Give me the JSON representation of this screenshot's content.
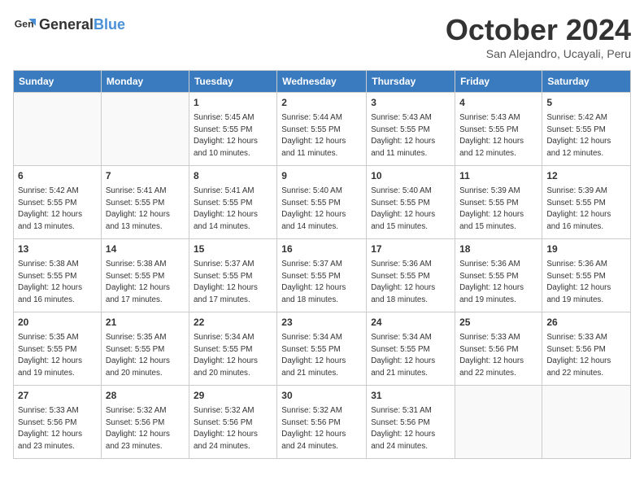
{
  "logo": {
    "general": "General",
    "blue": "Blue"
  },
  "header": {
    "month": "October 2024",
    "location": "San Alejandro, Ucayali, Peru"
  },
  "weekdays": [
    "Sunday",
    "Monday",
    "Tuesday",
    "Wednesday",
    "Thursday",
    "Friday",
    "Saturday"
  ],
  "weeks": [
    [
      {
        "day": "",
        "detail": ""
      },
      {
        "day": "",
        "detail": ""
      },
      {
        "day": "1",
        "detail": "Sunrise: 5:45 AM\nSunset: 5:55 PM\nDaylight: 12 hours\nand 10 minutes."
      },
      {
        "day": "2",
        "detail": "Sunrise: 5:44 AM\nSunset: 5:55 PM\nDaylight: 12 hours\nand 11 minutes."
      },
      {
        "day": "3",
        "detail": "Sunrise: 5:43 AM\nSunset: 5:55 PM\nDaylight: 12 hours\nand 11 minutes."
      },
      {
        "day": "4",
        "detail": "Sunrise: 5:43 AM\nSunset: 5:55 PM\nDaylight: 12 hours\nand 12 minutes."
      },
      {
        "day": "5",
        "detail": "Sunrise: 5:42 AM\nSunset: 5:55 PM\nDaylight: 12 hours\nand 12 minutes."
      }
    ],
    [
      {
        "day": "6",
        "detail": "Sunrise: 5:42 AM\nSunset: 5:55 PM\nDaylight: 12 hours\nand 13 minutes."
      },
      {
        "day": "7",
        "detail": "Sunrise: 5:41 AM\nSunset: 5:55 PM\nDaylight: 12 hours\nand 13 minutes."
      },
      {
        "day": "8",
        "detail": "Sunrise: 5:41 AM\nSunset: 5:55 PM\nDaylight: 12 hours\nand 14 minutes."
      },
      {
        "day": "9",
        "detail": "Sunrise: 5:40 AM\nSunset: 5:55 PM\nDaylight: 12 hours\nand 14 minutes."
      },
      {
        "day": "10",
        "detail": "Sunrise: 5:40 AM\nSunset: 5:55 PM\nDaylight: 12 hours\nand 15 minutes."
      },
      {
        "day": "11",
        "detail": "Sunrise: 5:39 AM\nSunset: 5:55 PM\nDaylight: 12 hours\nand 15 minutes."
      },
      {
        "day": "12",
        "detail": "Sunrise: 5:39 AM\nSunset: 5:55 PM\nDaylight: 12 hours\nand 16 minutes."
      }
    ],
    [
      {
        "day": "13",
        "detail": "Sunrise: 5:38 AM\nSunset: 5:55 PM\nDaylight: 12 hours\nand 16 minutes."
      },
      {
        "day": "14",
        "detail": "Sunrise: 5:38 AM\nSunset: 5:55 PM\nDaylight: 12 hours\nand 17 minutes."
      },
      {
        "day": "15",
        "detail": "Sunrise: 5:37 AM\nSunset: 5:55 PM\nDaylight: 12 hours\nand 17 minutes."
      },
      {
        "day": "16",
        "detail": "Sunrise: 5:37 AM\nSunset: 5:55 PM\nDaylight: 12 hours\nand 18 minutes."
      },
      {
        "day": "17",
        "detail": "Sunrise: 5:36 AM\nSunset: 5:55 PM\nDaylight: 12 hours\nand 18 minutes."
      },
      {
        "day": "18",
        "detail": "Sunrise: 5:36 AM\nSunset: 5:55 PM\nDaylight: 12 hours\nand 19 minutes."
      },
      {
        "day": "19",
        "detail": "Sunrise: 5:36 AM\nSunset: 5:55 PM\nDaylight: 12 hours\nand 19 minutes."
      }
    ],
    [
      {
        "day": "20",
        "detail": "Sunrise: 5:35 AM\nSunset: 5:55 PM\nDaylight: 12 hours\nand 19 minutes."
      },
      {
        "day": "21",
        "detail": "Sunrise: 5:35 AM\nSunset: 5:55 PM\nDaylight: 12 hours\nand 20 minutes."
      },
      {
        "day": "22",
        "detail": "Sunrise: 5:34 AM\nSunset: 5:55 PM\nDaylight: 12 hours\nand 20 minutes."
      },
      {
        "day": "23",
        "detail": "Sunrise: 5:34 AM\nSunset: 5:55 PM\nDaylight: 12 hours\nand 21 minutes."
      },
      {
        "day": "24",
        "detail": "Sunrise: 5:34 AM\nSunset: 5:55 PM\nDaylight: 12 hours\nand 21 minutes."
      },
      {
        "day": "25",
        "detail": "Sunrise: 5:33 AM\nSunset: 5:56 PM\nDaylight: 12 hours\nand 22 minutes."
      },
      {
        "day": "26",
        "detail": "Sunrise: 5:33 AM\nSunset: 5:56 PM\nDaylight: 12 hours\nand 22 minutes."
      }
    ],
    [
      {
        "day": "27",
        "detail": "Sunrise: 5:33 AM\nSunset: 5:56 PM\nDaylight: 12 hours\nand 23 minutes."
      },
      {
        "day": "28",
        "detail": "Sunrise: 5:32 AM\nSunset: 5:56 PM\nDaylight: 12 hours\nand 23 minutes."
      },
      {
        "day": "29",
        "detail": "Sunrise: 5:32 AM\nSunset: 5:56 PM\nDaylight: 12 hours\nand 24 minutes."
      },
      {
        "day": "30",
        "detail": "Sunrise: 5:32 AM\nSunset: 5:56 PM\nDaylight: 12 hours\nand 24 minutes."
      },
      {
        "day": "31",
        "detail": "Sunrise: 5:31 AM\nSunset: 5:56 PM\nDaylight: 12 hours\nand 24 minutes."
      },
      {
        "day": "",
        "detail": ""
      },
      {
        "day": "",
        "detail": ""
      }
    ]
  ]
}
